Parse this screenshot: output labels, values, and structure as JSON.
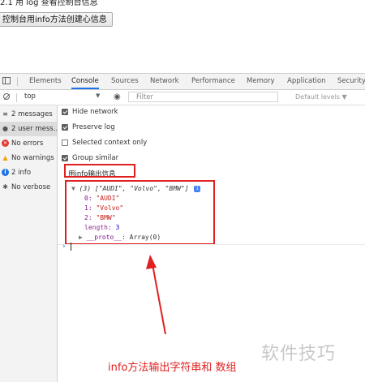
{
  "page": {
    "top_cut_text": "2.1 用 log 查看控制台信息",
    "button_label": "控制台用info方法创建心信息"
  },
  "devtools": {
    "tabs": [
      {
        "label": "Elements",
        "active": false
      },
      {
        "label": "Console",
        "active": true
      },
      {
        "label": "Sources",
        "active": false
      },
      {
        "label": "Network",
        "active": false
      },
      {
        "label": "Performance",
        "active": false
      },
      {
        "label": "Memory",
        "active": false
      },
      {
        "label": "Application",
        "active": false
      },
      {
        "label": "Security",
        "active": false
      }
    ],
    "toolbar": {
      "context": "top",
      "context_caret": "▼",
      "filter_placeholder": "Filter",
      "levels": "Default levels ▼"
    },
    "sidebar": [
      {
        "icon": "list-icon",
        "glyph": "≡",
        "label": "2 messages",
        "selected": false,
        "color": "#444444"
      },
      {
        "icon": "user-icon",
        "glyph": "●",
        "label": "2 user mess...",
        "selected": true,
        "color": "#555555"
      },
      {
        "icon": "error-icon",
        "glyph": "✕",
        "label": "No errors",
        "selected": false,
        "color": "#e53935"
      },
      {
        "icon": "warning-icon",
        "glyph": "▲",
        "label": "No warnings",
        "selected": false,
        "color": "#f4a300"
      },
      {
        "icon": "info-icon",
        "glyph": "i",
        "label": "2 info",
        "selected": false,
        "color": "#1a73e8"
      },
      {
        "icon": "verbose-icon",
        "glyph": "✱",
        "label": "No verbose",
        "selected": false,
        "color": "#555555"
      }
    ],
    "settings": [
      {
        "label": "Hide network",
        "checked": true
      },
      {
        "label": "Preserve log",
        "checked": true
      },
      {
        "label": "Selected context only",
        "checked": false
      },
      {
        "label": "Group similar",
        "checked": true
      }
    ],
    "console": {
      "log_message": "用info输出信息",
      "array_summary_prefix": "▼",
      "array_summary": "(3) [\"AUDI\", \"Volvo\", \"BMW\"]",
      "info_badge": "i",
      "entries": [
        {
          "key": "0",
          "value": "\"AUDI\""
        },
        {
          "key": "1",
          "value": "\"Volvo\""
        },
        {
          "key": "2",
          "value": "\"BMW\""
        }
      ],
      "length_key": "length",
      "length_value": "3",
      "proto_prefix": "▶",
      "proto_key": "__proto__",
      "proto_value": "Array(0)",
      "prompt": "›"
    }
  },
  "annotation": {
    "text": "info方法输出字符串和 数组",
    "color": "#e02020"
  },
  "watermark": "软件技巧"
}
